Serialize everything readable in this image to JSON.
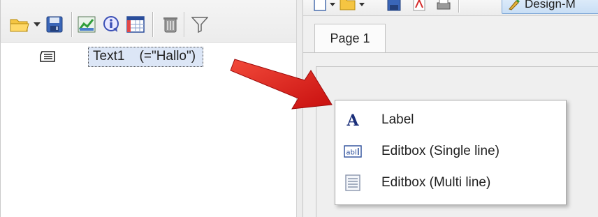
{
  "left_panel": {
    "toolbar": [
      {
        "name": "open-folder-icon"
      },
      {
        "name": "dropdown-arrow-icon"
      },
      {
        "name": "save-icon"
      },
      {
        "name": "chart-icon"
      },
      {
        "name": "info-icon"
      },
      {
        "name": "table-icon"
      },
      {
        "name": "trash-icon"
      },
      {
        "name": "filter-icon"
      }
    ],
    "tree": {
      "item_label": "Text1    (=\"Hallo\")",
      "item_icon": "text-field-icon"
    }
  },
  "right_panel": {
    "toolbar": {
      "design_button_label": "Design-M"
    },
    "tabs": [
      {
        "label": "Page 1"
      }
    ]
  },
  "context_menu": {
    "items": [
      {
        "label": "Label",
        "icon": "label-a-icon"
      },
      {
        "label": "Editbox (Single line)",
        "icon": "editbox-single-icon",
        "icon_text": "abl"
      },
      {
        "label": "Editbox (Multi line)",
        "icon": "editbox-multi-icon"
      }
    ]
  },
  "colors": {
    "arrow": "#e01f1f",
    "selection": "#dce6f6",
    "label_icon": "#1b2f7a"
  }
}
